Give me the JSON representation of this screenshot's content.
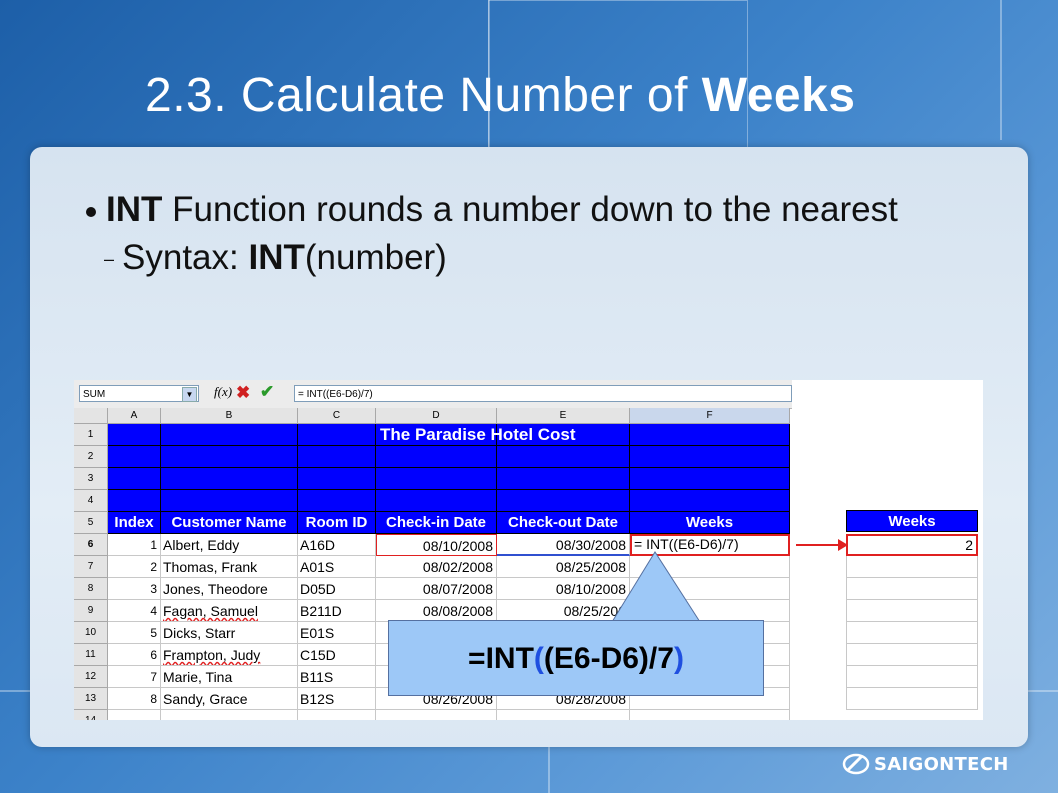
{
  "slide": {
    "title_prefix": "2.3. Calculate Number of ",
    "title_bold": "Weeks",
    "bullet_bold": "INT",
    "bullet_text": " Function rounds a number down to the nearest",
    "sub_prefix": "Syntax: ",
    "sub_bold": "INT",
    "sub_suffix": "(number)"
  },
  "spreadsheet": {
    "name_box": "SUM",
    "fx_label": "f(x)",
    "formula": "= INT((E6-D6)/7)",
    "columns": [
      "A",
      "B",
      "C",
      "D",
      "E",
      "F"
    ],
    "rows": [
      "1",
      "2",
      "3",
      "4",
      "5",
      "6",
      "7",
      "8",
      "9",
      "10",
      "11",
      "12",
      "13",
      "14"
    ],
    "banner": "The Paradise Hotel Cost",
    "headers": [
      "Index",
      "Customer Name",
      "Room ID",
      "Check-in Date",
      "Check-out Date",
      "Weeks"
    ],
    "data": [
      [
        "1",
        "Albert, Eddy",
        "A16D",
        "08/10/2008",
        "08/30/2008",
        "= INT((E6-D6)/7)"
      ],
      [
        "2",
        "Thomas, Frank",
        "A01S",
        "08/02/2008",
        "08/25/2008",
        ""
      ],
      [
        "3",
        "Jones, Theodore",
        "D05D",
        "08/07/2008",
        "08/10/2008",
        ""
      ],
      [
        "4",
        "Fagan, Samuel",
        "B211D",
        "08/08/2008",
        "08/25/200",
        ""
      ],
      [
        "5",
        "Dicks, Starr",
        "E01S",
        "",
        "",
        ""
      ],
      [
        "6",
        "Frampton, Judy",
        "C15D",
        "",
        "",
        ""
      ],
      [
        "7",
        "Marie, Tina",
        "B11S",
        "",
        "",
        ""
      ],
      [
        "8",
        "Sandy, Grace",
        "B12S",
        "08/26/2008",
        "08/28/2008",
        ""
      ]
    ],
    "result_header": "Weeks",
    "result_value": "2"
  },
  "callout": {
    "prefix": "=INT",
    "open_paren": "(",
    "middle": "(E6-D6)/7",
    "close_paren": ")"
  },
  "brand": {
    "logo_text": "SAIGONTECH"
  },
  "colors": {
    "header_blue": "#0000ff",
    "highlight_red": "#e02020",
    "callout_fill": "#9dc8f7"
  }
}
